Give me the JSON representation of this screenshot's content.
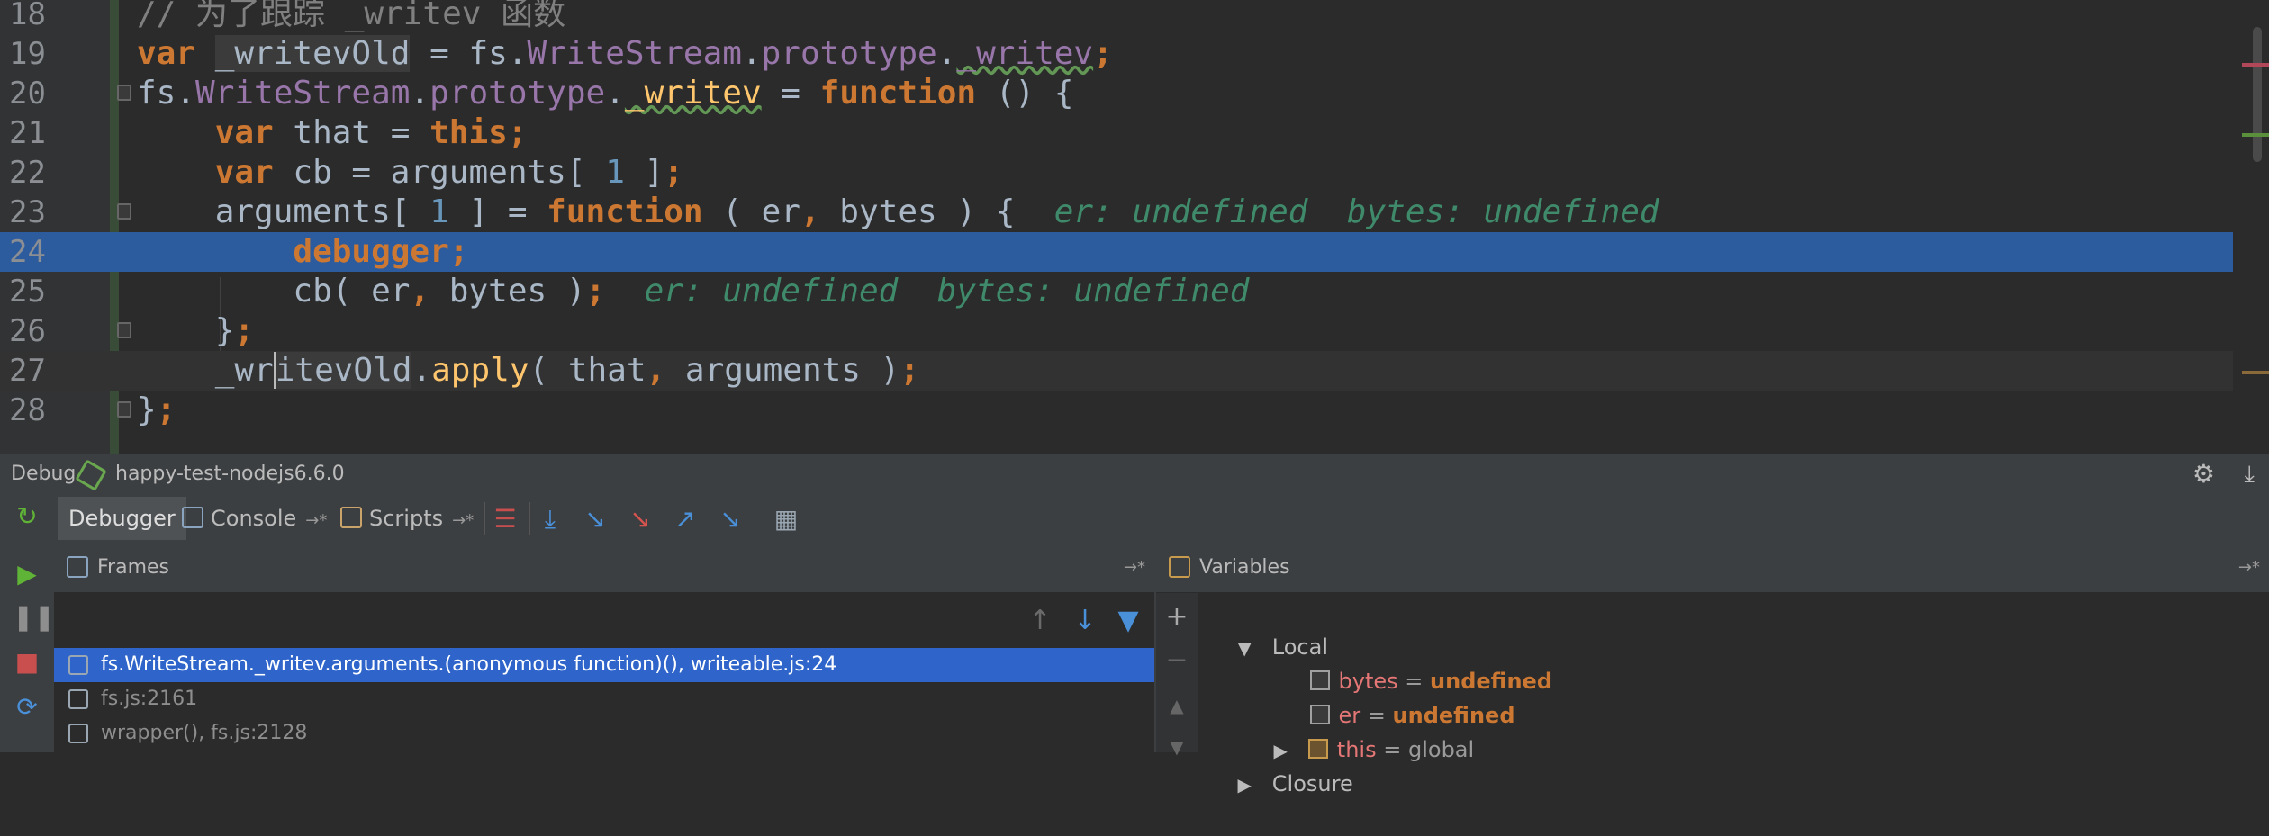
{
  "editor": {
    "lines": [
      {
        "num": "18",
        "text": "// 为了跟踪 _writev 函数"
      },
      {
        "num": "19",
        "text": "var _writevOld = fs.WriteStream.prototype._writev;"
      },
      {
        "num": "20",
        "text": "fs.WriteStream.prototype._writev = function () {"
      },
      {
        "num": "21",
        "text": "    var that = this;"
      },
      {
        "num": "22",
        "text": "    var cb = arguments[ 1 ];"
      },
      {
        "num": "23",
        "text": "    arguments[ 1 ] = function ( er, bytes ) {",
        "hint": "er: undefined  bytes: undefined"
      },
      {
        "num": "24",
        "text": "        debugger;"
      },
      {
        "num": "25",
        "text": "        cb( er, bytes );",
        "hint": "er: undefined  bytes: undefined"
      },
      {
        "num": "26",
        "text": "    };"
      },
      {
        "num": "27",
        "text": "    _writevOld.apply( that, arguments );"
      },
      {
        "num": "28",
        "text": "};"
      }
    ],
    "colors": {
      "keyword": "#cc7832",
      "property": "#9876aa",
      "function": "#ffc66d",
      "number": "#6897bb",
      "comment": "#808080",
      "inlay_hint": "#3f8a6b",
      "exec_line": "#2d5c9e"
    }
  },
  "debug_bar": {
    "label": "Debug",
    "config_name": "happy-test-nodejs6.6.0",
    "icons": [
      "nodejs-icon",
      "gear-icon",
      "pin-icon"
    ]
  },
  "tabs": [
    {
      "label": "Debugger",
      "active": true
    },
    {
      "label": "Console",
      "icon": "console-icon"
    },
    {
      "label": "Scripts",
      "icon": "js-icon"
    }
  ],
  "step_buttons": [
    "show-execution-point-icon",
    "step-over-icon",
    "step-into-icon",
    "force-step-into-icon",
    "step-out-icon",
    "run-to-cursor-icon",
    "evaluate-expression-icon"
  ],
  "left_toolbar": [
    "rerun-icon",
    "resume-icon",
    "pause-icon",
    "stop-icon",
    "refresh-icon"
  ],
  "frames": {
    "title": "Frames",
    "items": [
      {
        "label": "fs.WriteStream._writev.arguments.(anonymous function)(), writeable.js:24",
        "selected": true
      },
      {
        "label": "fs.js:2161"
      },
      {
        "label": "wrapper(), fs.js:2128"
      }
    ]
  },
  "variables": {
    "title": "Variables",
    "local_label": "Local",
    "items": [
      {
        "name": "bytes",
        "eq": "=",
        "value": "undefined"
      },
      {
        "name": "er",
        "eq": "=",
        "value": "undefined"
      },
      {
        "name": "this",
        "eq": "=",
        "value": "global"
      }
    ],
    "closure_label": "Closure"
  },
  "pin_glyph": "→*"
}
